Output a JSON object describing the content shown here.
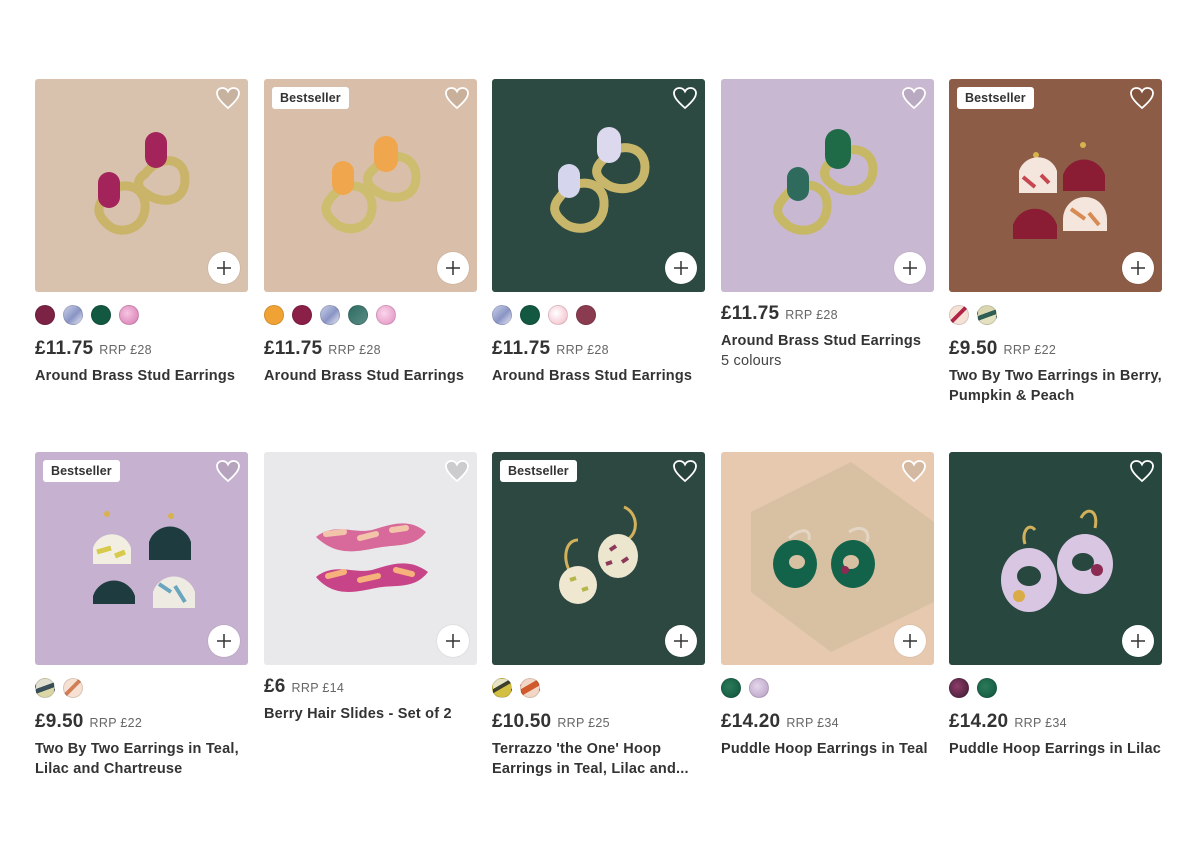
{
  "icons": {
    "favourite": "heart-outline-icon",
    "quick_add": "plus-icon"
  },
  "colors": {
    "berry": "#7b2245",
    "lilac_marble": "#b8bfdc",
    "teal": "#1f4d3e",
    "pink_marble": "#e8a4c9",
    "pumpkin": "#ef9d3a",
    "peach_marble": "#f3c0b0",
    "card_bg_sand": "#d4bda8",
    "card_bg_teal": "#2c4841",
    "card_bg_lilac": "#c8b7d0",
    "card_bg_brown": "#8a5b45"
  },
  "products": [
    {
      "badge": "",
      "price": "£11.75",
      "rrp": "RRP £28",
      "title": "Around Brass Stud Earrings",
      "subtitle": "",
      "swatches": [
        "berry",
        "lilac-marble",
        "teal",
        "pink-marble"
      ]
    },
    {
      "badge": "Bestseller",
      "price": "£11.75",
      "rrp": "RRP £28",
      "title": "Around Brass Stud Earrings",
      "subtitle": "",
      "swatches": [
        "pumpkin",
        "berry",
        "lilac-marble",
        "teal-marble",
        "pink-marble"
      ]
    },
    {
      "badge": "",
      "price": "£11.75",
      "rrp": "RRP £28",
      "title": "Around Brass Stud Earrings",
      "subtitle": "",
      "swatches": [
        "lilac-marble",
        "teal",
        "peach-marble",
        "berry"
      ]
    },
    {
      "badge": "",
      "price": "£11.75",
      "rrp": "RRP £28",
      "title": "Around Brass Stud Earrings",
      "subtitle": "5 colours",
      "swatches": []
    },
    {
      "badge": "Bestseller",
      "price": "£9.50",
      "rrp": "RRP £22",
      "title": "Two By Two Earrings in Berry,",
      "title2": "Pumpkin & Peach",
      "subtitle": "",
      "swatches": [
        "berry-peach",
        "teal-chartreuse"
      ]
    },
    {
      "badge": "Bestseller",
      "price": "£9.50",
      "rrp": "RRP £22",
      "title": "Two By Two Earrings in Teal,",
      "title2": "Lilac and Chartreuse",
      "subtitle": "",
      "swatches": [
        "teal-chartreuse",
        "berry-peach"
      ]
    },
    {
      "badge": "",
      "price": "£6",
      "rrp": "RRP £14",
      "title": "Berry Hair Slides - Set of 2",
      "subtitle": "",
      "swatches": []
    },
    {
      "badge": "Bestseller",
      "price": "£10.50",
      "rrp": "RRP £25",
      "title": "Terrazzo 'the One' Hoop",
      "title2": "Earrings in Teal, Lilac and...",
      "subtitle": "",
      "swatches": [
        "teal-terrazzo",
        "orange-terrazzo"
      ]
    },
    {
      "badge": "",
      "price": "£14.20",
      "rrp": "RRP £34",
      "title": "Puddle Hoop Earrings in Teal",
      "subtitle": "",
      "swatches": [
        "teal",
        "lilac"
      ]
    },
    {
      "badge": "",
      "price": "£14.20",
      "rrp": "RRP £34",
      "title": "Puddle Hoop Earrings in Lilac",
      "subtitle": "",
      "swatches": [
        "lilac-berry",
        "teal"
      ]
    }
  ]
}
